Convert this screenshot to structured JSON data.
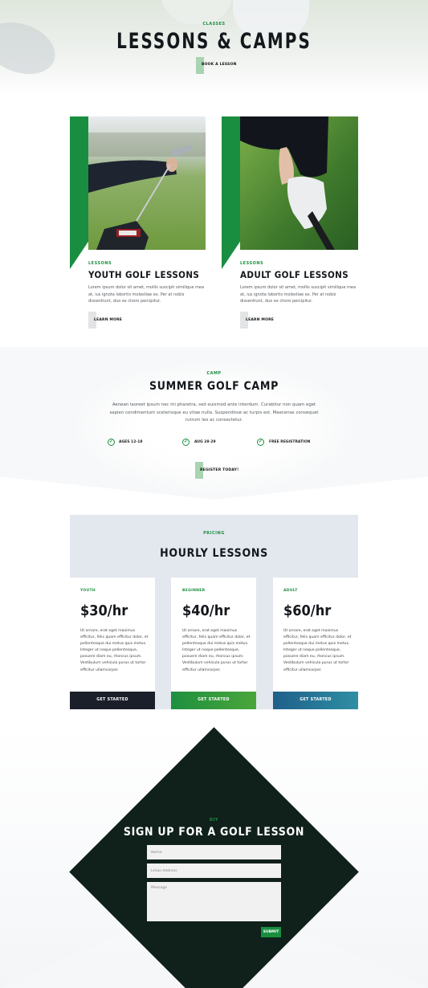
{
  "hero": {
    "kicker": "CLASSES",
    "title": "LESSONS & CAMPS",
    "button": "BOOK A LESSON"
  },
  "lessons": [
    {
      "kicker": "LESSONS",
      "title": "YOUTH GOLF LESSONS",
      "body": "Lorem ipsum dolor sit amet, mollis suscipit similique mea at, ius ignota lobortis molestiae ex. Per at nobis dissentiunt, duo ex choro percipitur.",
      "button": "LEARN MORE"
    },
    {
      "kicker": "LESSONS",
      "title": "ADULT GOLF LESSONS",
      "body": "Lorem ipsum dolor sit amet, mollis suscipit similique mea at, ius ignota lobortis molestiae ex. Per at nobis dissentiunt, duo ex choro percipitur.",
      "button": "LEARN MORE"
    }
  ],
  "camp": {
    "kicker": "CAMP",
    "title": "SUMMER GOLF CAMP",
    "body": "Aenean laoreet ipsum nec mi pharetra, sed euismod ante interdum. Curabitur non quam eget sapien condimentum scelerisque eu vitae nulla. Suspendisse ac turpis est. Maecenas consequat rutrum leo ac consectetur.",
    "features": [
      "AGES 12-18",
      "AUG 28-29",
      "FREE REGISTRATION"
    ],
    "button": "REGISTER TODAY!"
  },
  "pricing": {
    "kicker": "PRICING",
    "title": "HOURLY LESSONS",
    "plans": [
      {
        "tier": "YOUTH",
        "price": "$30/hr",
        "desc": "Ut ornare, erat eget maximus efficitur, felis quam efficitur dolor, et pellentesque dui metus quis metus. Integer ut neque pellentesque, posuere diam eu, rhoncus ipsum. Vestibulum vehicula purus ut tortor efficitur ullamcorper.",
        "button": "GET STARTED",
        "color": "#1b1f2a"
      },
      {
        "tier": "BEGINNER",
        "price": "$40/hr",
        "desc": "Ut ornare, erat eget maximus efficitur, felis quam efficitur dolor, et pellentesque dui metus quis metus. Integer ut neque pellentesque, posuere diam eu, rhoncus ipsum. Vestibulum vehicula purus ut tortor efficitur ullamcorper.",
        "button": "GET STARTED",
        "color": "#2f9a3e"
      },
      {
        "tier": "ADULT",
        "price": "$60/hr",
        "desc": "Ut ornare, erat eget maximus efficitur, felis quam efficitur dolor, et pellentesque dui metus quis metus. Integer ut neque pellentesque, posuere diam eu, rhoncus ipsum. Vestibulum vehicula purus ut tortor efficitur ullamcorper.",
        "button": "GET STARTED",
        "color": "#23708f"
      }
    ]
  },
  "signup": {
    "kicker": "DIY",
    "title": "SIGN UP FOR A GOLF LESSON",
    "name_placeholder": "Name",
    "email_placeholder": "Email Address",
    "message_placeholder": "Message",
    "submit": "SUBMIT"
  },
  "colors": {
    "accent_green": "#1a8e40",
    "dark": "#10201a",
    "pricing_bg": "#e3e7ee"
  }
}
